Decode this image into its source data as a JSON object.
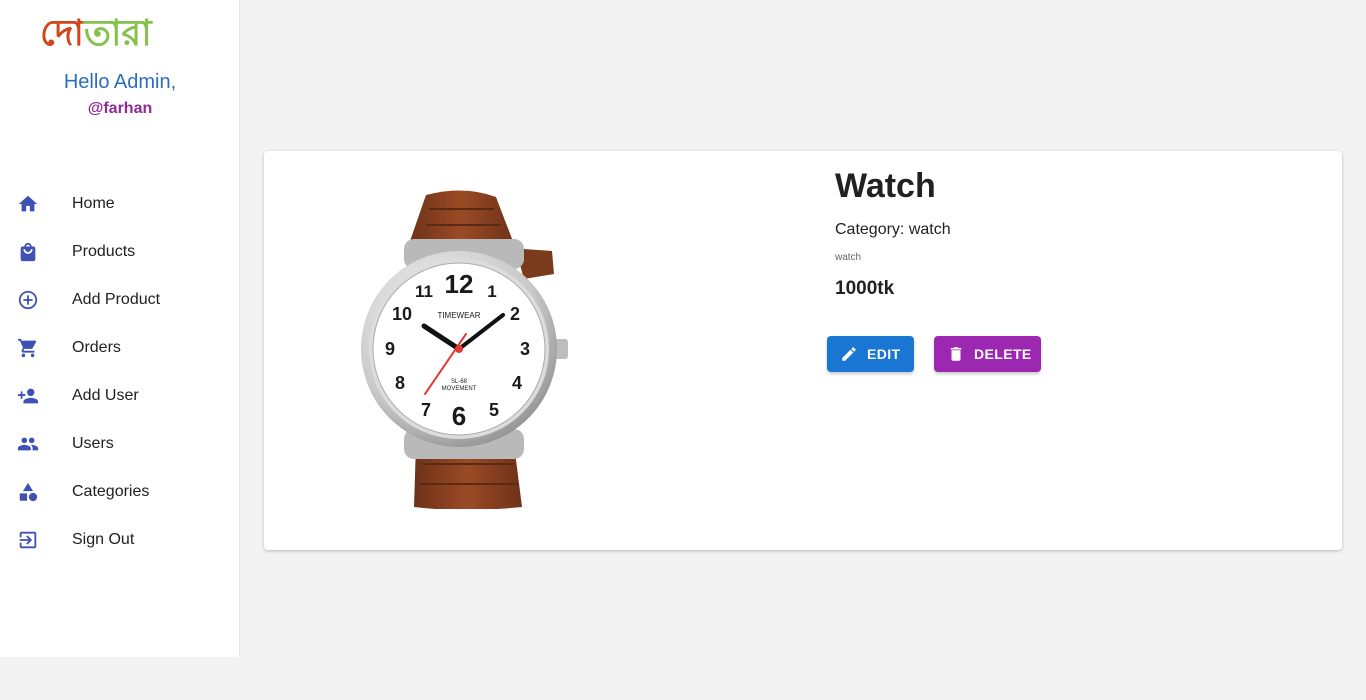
{
  "sidebar": {
    "logo": {
      "part1": "দো",
      "part2": "তারা"
    },
    "greeting": "Hello Admin,",
    "handle": "@farhan",
    "items": [
      {
        "label": "Home",
        "icon": "home-icon"
      },
      {
        "label": "Products",
        "icon": "shopping-bag-icon"
      },
      {
        "label": "Add Product",
        "icon": "add-circle-icon"
      },
      {
        "label": "Orders",
        "icon": "cart-icon"
      },
      {
        "label": "Add User",
        "icon": "person-add-icon"
      },
      {
        "label": "Users",
        "icon": "people-icon"
      },
      {
        "label": "Categories",
        "icon": "category-icon"
      },
      {
        "label": "Sign Out",
        "icon": "logout-icon"
      }
    ]
  },
  "product": {
    "title": "Watch",
    "category_label": "Category:",
    "category": "watch",
    "description": "watch",
    "price": "1000tk",
    "image_text": {
      "brand": "TIMEWEAR",
      "model": "SL-68",
      "movement": "MOVEMENT"
    },
    "edit_label": "EDIT",
    "delete_label": "DELETE"
  },
  "colors": {
    "accent_blue": "#1976d2",
    "accent_purple": "#9c27b0",
    "nav_icon": "#3f51b5",
    "greeting": "#2d6dbf",
    "handle": "#8e2b94",
    "logo_red": "#d2461e",
    "logo_green": "#86c14b"
  }
}
